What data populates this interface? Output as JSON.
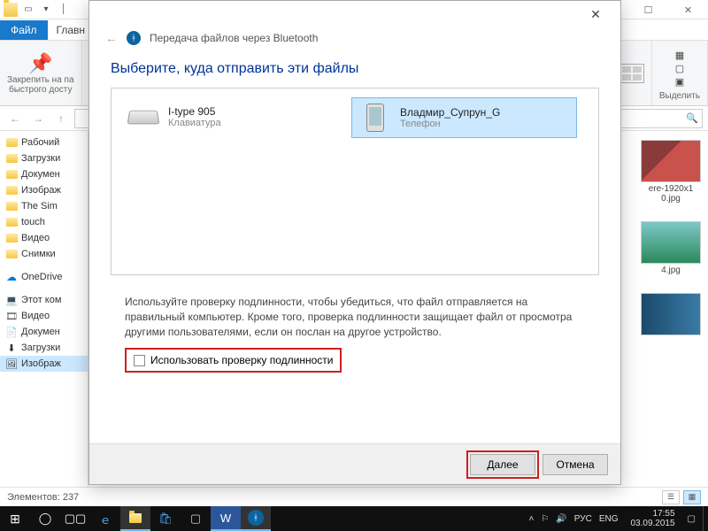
{
  "explorer": {
    "ribbon": {
      "file": "Файл",
      "home": "Главн"
    },
    "pin": {
      "line1": "Закрепить на па",
      "line2": "быстрого досту"
    },
    "select_label": "Выделить",
    "sidebar": [
      {
        "label": "Рабочий",
        "icon": "folder"
      },
      {
        "label": "Загрузки",
        "icon": "folder"
      },
      {
        "label": "Докумен",
        "icon": "folder"
      },
      {
        "label": "Изображ",
        "icon": "folder"
      },
      {
        "label": "The Sim",
        "icon": "folder"
      },
      {
        "label": "touch",
        "icon": "folder"
      },
      {
        "label": "Видео",
        "icon": "folder"
      },
      {
        "label": "Снимки",
        "icon": "folder"
      },
      {
        "label": "OneDrive",
        "icon": "onedrive"
      },
      {
        "label": "Этот ком",
        "icon": "pc"
      },
      {
        "label": "Видео",
        "icon": "video"
      },
      {
        "label": "Докумен",
        "icon": "doc"
      },
      {
        "label": "Загрузки",
        "icon": "down"
      },
      {
        "label": "Изображ",
        "icon": "img",
        "selected": true
      }
    ],
    "thumbs": [
      {
        "caption": "ere-1920x1\n0.jpg",
        "cls": "t1"
      },
      {
        "caption": "4.jpg",
        "cls": "t2"
      },
      {
        "caption": "",
        "cls": "t3"
      }
    ],
    "status": "Элементов: 237"
  },
  "dialog": {
    "title": "Передача файлов через Bluetooth",
    "heading": "Выберите, куда отправить эти файлы",
    "devices": [
      {
        "name": "I-type 905",
        "type": "Клавиатура",
        "icon": "keyboard"
      },
      {
        "name": "Владмир_Супрун_G",
        "type": "Телефон",
        "icon": "phone",
        "selected": true
      }
    ],
    "description": "Используйте проверку подлинности, чтобы убедиться, что файл отправляется на правильный компьютер. Кроме того, проверка подлинности защищает файл от просмотра другими пользователями, если он послан на другое устройство.",
    "checkbox_label": "Использовать проверку подлинности",
    "btn_next": "Далее",
    "btn_cancel": "Отмена"
  },
  "taskbar": {
    "lang": "РУС",
    "kbd": "ENG",
    "time": "17:55",
    "date": "03.09.2015"
  }
}
